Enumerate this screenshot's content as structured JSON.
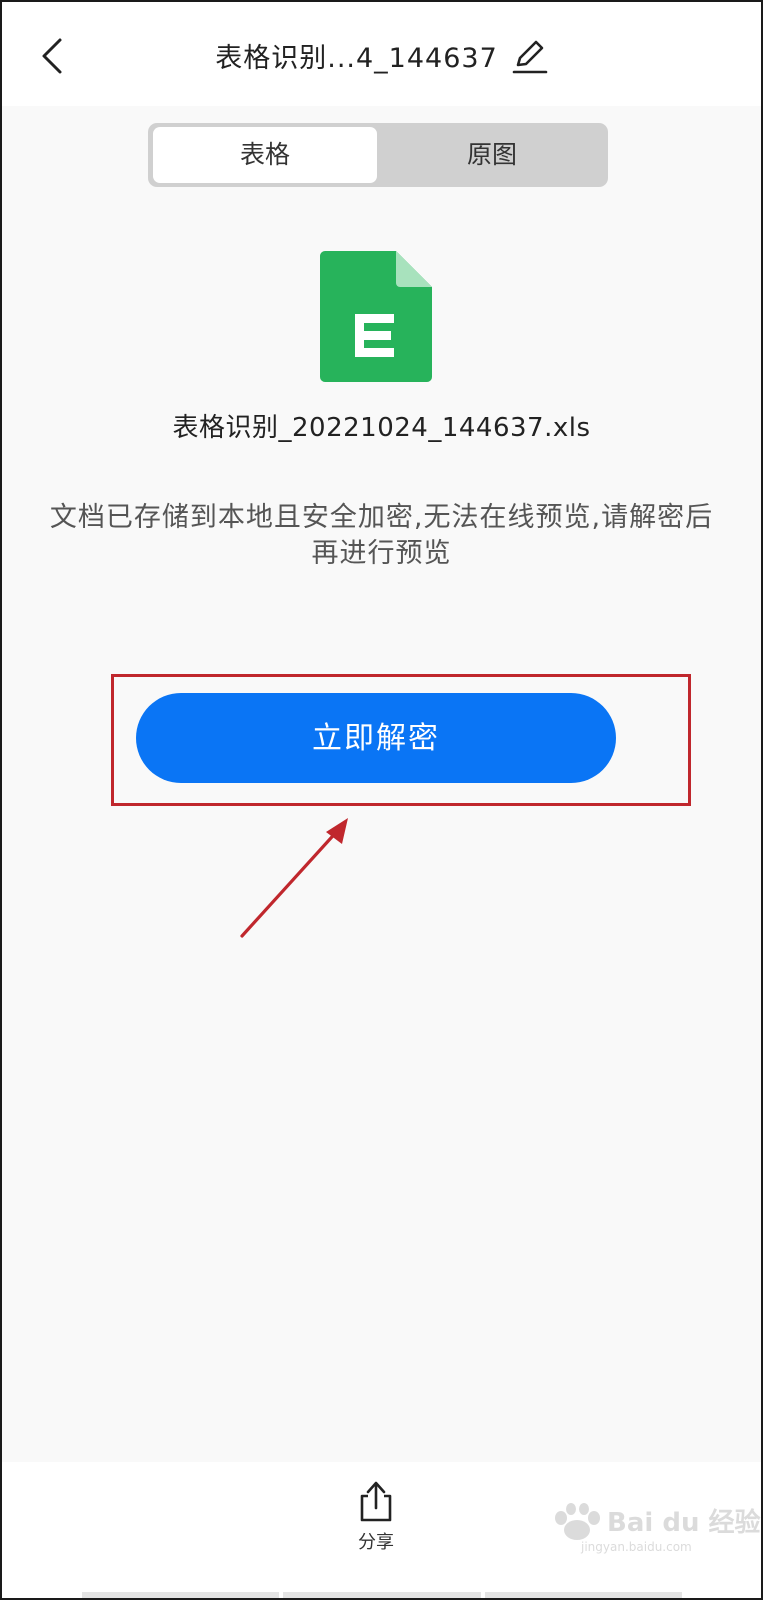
{
  "header": {
    "back_icon": "chevron-left-icon",
    "title": "表格识别...4_144637",
    "edit_icon": "pencil-icon"
  },
  "tabs": [
    {
      "label": "表格",
      "selected": true
    },
    {
      "label": "原图",
      "selected": false
    }
  ],
  "file": {
    "icon": "excel-file-icon",
    "icon_color": "#27b35b",
    "icon_letter": "E",
    "name": "表格识别_20221024_144637.xls"
  },
  "notice": "文档已存储到本地且安全加密,无法在线预览,请解密后再进行预览",
  "decrypt_button": {
    "label": "立即解密",
    "color": "#0a75f5"
  },
  "annotation": {
    "highlight_color": "#c0272d"
  },
  "bottom_bar": {
    "share_icon": "share-upload-icon",
    "share_label": "分享"
  },
  "watermark": {
    "brand": "Bai du 经验",
    "url": "jingyan.baidu.com"
  }
}
